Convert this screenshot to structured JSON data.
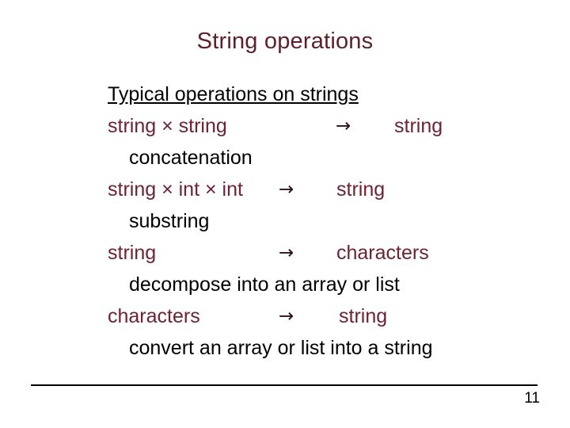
{
  "slide": {
    "title": "String operations",
    "title_color": "#5e1f2b",
    "body_color_signature": "#6e2234",
    "body_color_description": "#000000",
    "heading": "Typical operations on strings",
    "operations": [
      {
        "signature_left": "string × string",
        "arrow": "→",
        "signature_right": "string",
        "description": "concatenation"
      },
      {
        "signature_left": "string × int × int",
        "arrow": "→",
        "signature_right": "string",
        "description": "substring"
      },
      {
        "signature_left": "string",
        "arrow": "→",
        "signature_right": "characters",
        "description": "decompose into an array or list"
      },
      {
        "signature_left": "characters",
        "arrow": "→",
        "signature_right": "string",
        "description": "convert an array or list into a string"
      }
    ],
    "page_number": "11"
  }
}
